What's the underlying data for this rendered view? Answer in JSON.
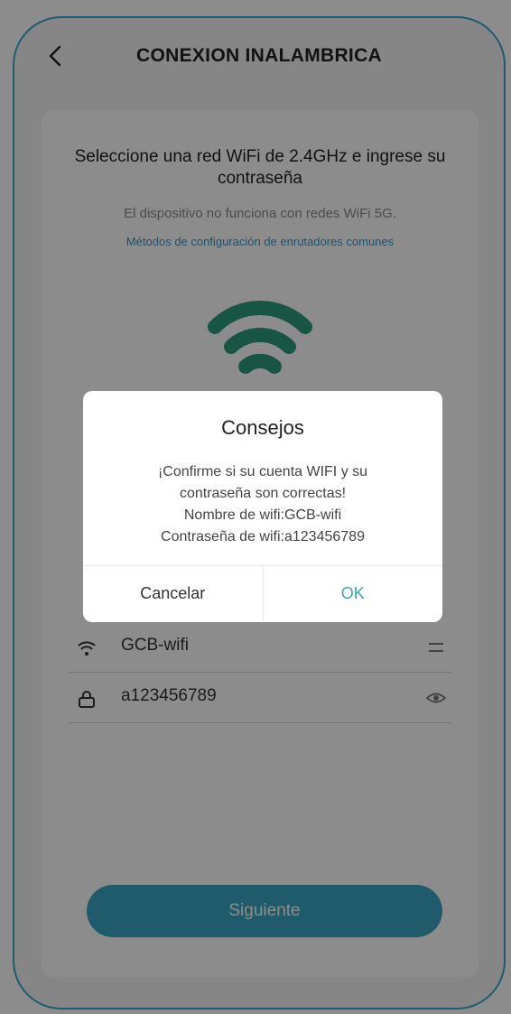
{
  "header": {
    "title": "CONEXION INALAMBRICA",
    "back_icon": "chevron-left-icon"
  },
  "main": {
    "heading": "Seleccione una red WiFi de 2.4GHz e ingrese su contraseña",
    "note": "El dispositivo no funciona con redes WiFi 5G.",
    "link": "Métodos de configuración de enrutadores comunes",
    "wifi_icon": "wifi-icon",
    "ssid_field": {
      "icon": "wifi-icon",
      "value": "GCB-wifi",
      "right_icon": "swap-icon"
    },
    "password_field": {
      "icon": "lock-icon",
      "value": "a123456789",
      "right_icon": "eye-icon"
    },
    "next_label": "Siguiente"
  },
  "dialog": {
    "title": "Consejos",
    "lines": [
      "¡Confirme si su cuenta WIFI y su",
      "contraseña son correctas!",
      "Nombre de wifi:GCB-wifi",
      "Contraseña de wifi:a123456789"
    ],
    "cancel_label": "Cancelar",
    "ok_label": "OK"
  },
  "colors": {
    "accent": "#3aa6c1",
    "link": "#2f9bd0",
    "frame_border": "#3ba6c9",
    "wifi_icon": "#2e9b7f"
  }
}
